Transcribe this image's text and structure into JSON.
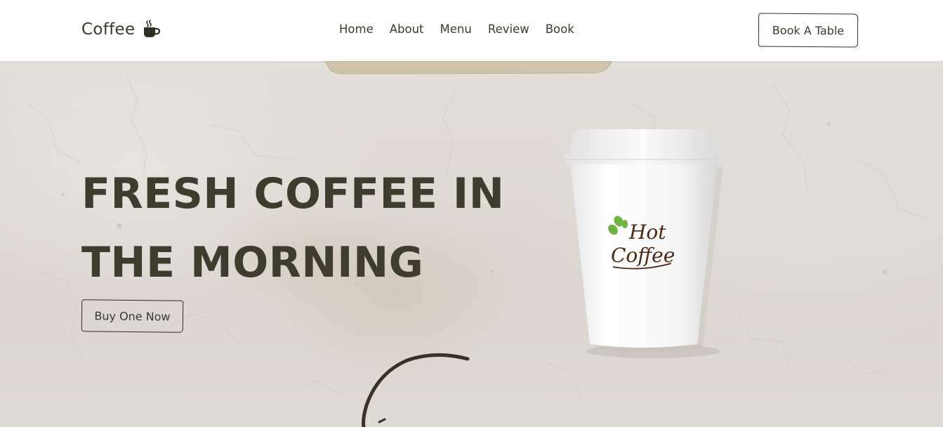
{
  "header": {
    "logo_text": "Coffee",
    "logo_icon": "coffee-cup-icon",
    "nav": [
      {
        "label": "Home"
      },
      {
        "label": "About"
      },
      {
        "label": "Menu"
      },
      {
        "label": "Review"
      },
      {
        "label": "Book"
      }
    ],
    "cta_label": "Book A Table"
  },
  "hero": {
    "title_line1": "FRESH COFFEE IN",
    "title_line2": "THE MORNING",
    "button_label": "Buy One Now",
    "cup_logo_line1": "Hot",
    "cup_logo_line2": "Coffee"
  },
  "colors": {
    "text": "#3b3a2e",
    "title": "#3d3c2d",
    "header_bg": "#ffffff",
    "bean_green": "#6db33f",
    "logo_brown": "#4a2a14"
  }
}
